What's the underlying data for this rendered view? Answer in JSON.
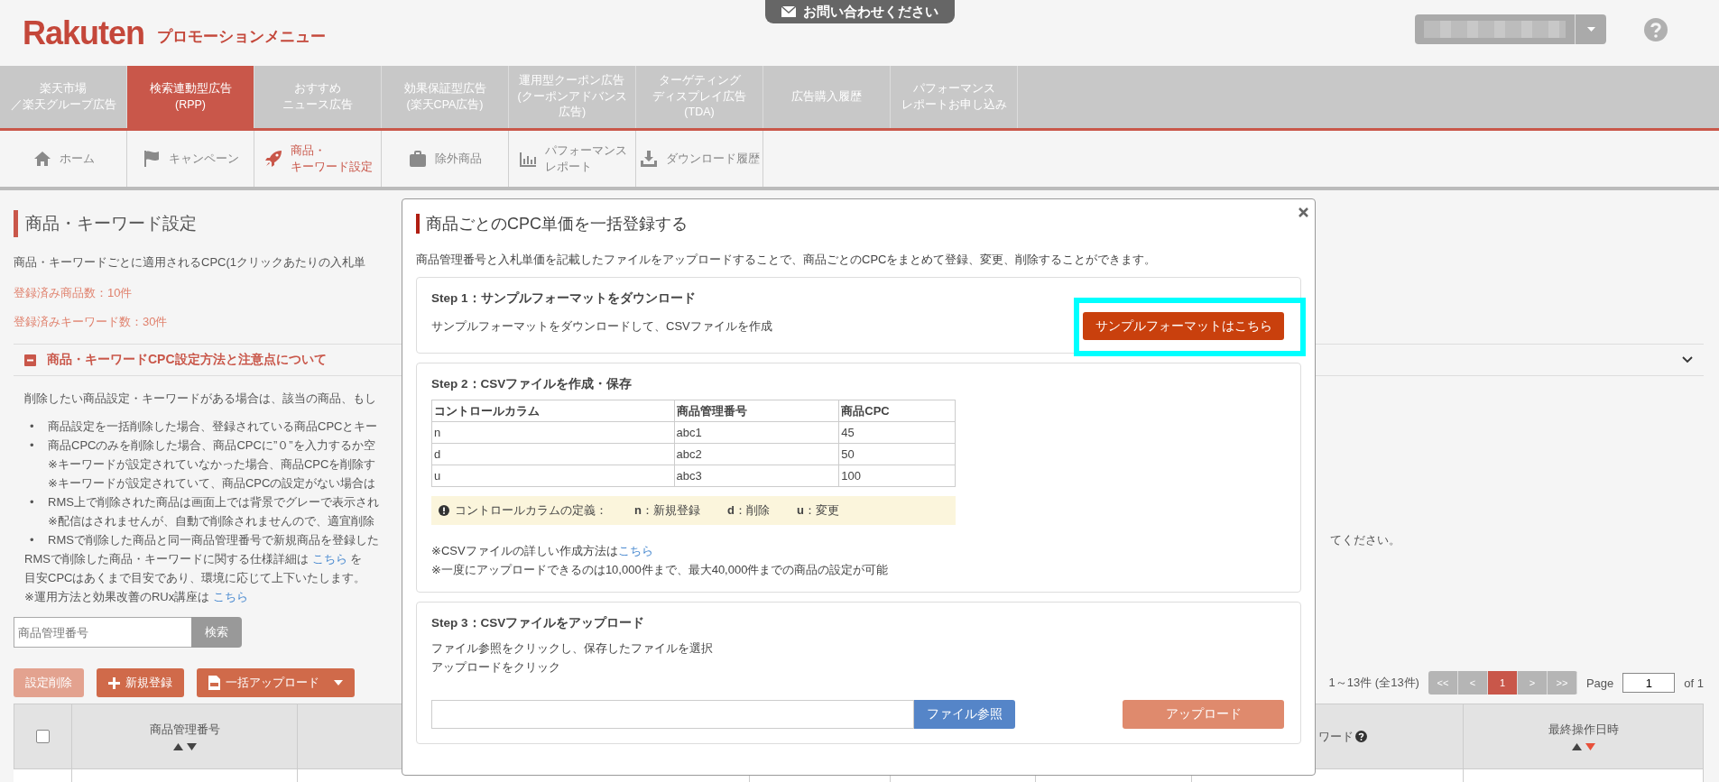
{
  "header": {
    "logo": "Rakuten",
    "subtitle": "プロモーションメニュー",
    "contact_tab": "お問い合わせください"
  },
  "main_nav": [
    {
      "lines": [
        "楽天市場",
        "／楽天グループ広告"
      ],
      "selected": false
    },
    {
      "lines": [
        "検索連動型広告",
        "(RPP)"
      ],
      "selected": true
    },
    {
      "lines": [
        "おすすめ",
        "ニュース広告"
      ],
      "selected": false
    },
    {
      "lines": [
        "効果保証型広告",
        "(楽天CPA広告)"
      ],
      "selected": false
    },
    {
      "lines": [
        "運用型クーポン広告",
        "(クーポンアドバンス",
        "広告)"
      ],
      "selected": false
    },
    {
      "lines": [
        "ターゲティング",
        "ディスプレイ広告",
        "(TDA)"
      ],
      "selected": false
    },
    {
      "lines": [
        "広告購入履歴"
      ],
      "selected": false
    },
    {
      "lines": [
        "パフォーマンス",
        "レポートお申し込み"
      ],
      "selected": false
    }
  ],
  "sub_nav": [
    {
      "lines": [
        "ホーム"
      ],
      "selected": false
    },
    {
      "lines": [
        "キャンペーン"
      ],
      "selected": false
    },
    {
      "lines": [
        "商品・",
        "キーワード設定"
      ],
      "selected": true
    },
    {
      "lines": [
        "除外商品"
      ],
      "selected": false
    },
    {
      "lines": [
        "パフォーマンス",
        "レポート"
      ],
      "selected": false
    },
    {
      "lines": [
        "ダウンロード履歴"
      ],
      "selected": false
    }
  ],
  "page": {
    "title": "商品・キーワード設定",
    "description": "商品・キーワードごとに適用されるCPC(1クリックあたりの入札単",
    "registered_items": "登録済み商品数：10件",
    "registered_keywords": "登録済みキーワード数：30件"
  },
  "notes": {
    "title": "商品・キーワードCPC設定方法と注意点について",
    "expanded": true,
    "intro": "削除したい商品設定・キーワードがある場合は、該当の商品、もし",
    "bullets": [
      {
        "marker": "•",
        "text": "商品設定を一括削除した場合、登録されている商品CPCとキー"
      },
      {
        "marker": "•",
        "text": "商品CPCのみを削除した場合、商品CPCに”０”を入力するか空",
        "sub": [
          "※キーワードが設定されていなかった場合、商品CPCを削除す",
          "※キーワードが設定されていて、商品CPCの設定がない場合は"
        ]
      },
      {
        "marker": "•",
        "text": "RMS上で削除された商品は画面上では背景でグレーで表示され",
        "sub": [
          "※配信はされませんが、自動で削除されませんので、適宜削除"
        ]
      },
      {
        "marker": "•",
        "text": "RMSで削除した商品と同一商品管理番号で新規商品を登録した",
        "continuation": "てください。"
      }
    ],
    "footer": [
      {
        "text": "RMSで削除した商品・キーワードに関する仕様詳細は",
        "link": "こちら",
        "after": "を"
      },
      {
        "text": "目安CPCはあくまで目安であり、環境に応じて上下いたします。"
      },
      {
        "text": "※運用方法と効果改善のRUx講座は",
        "link": "こちら"
      }
    ]
  },
  "search": {
    "placeholder": "商品管理番号",
    "button": "検索"
  },
  "actions": [
    {
      "label": "設定削除",
      "disabled": true
    },
    {
      "label": "新規登録",
      "disabled": false
    },
    {
      "label": "一括アップロード",
      "disabled": false
    }
  ],
  "pagination": {
    "summary": "1～13件 (全13件)",
    "buttons": [
      {
        "label": "<<",
        "selected": false
      },
      {
        "label": "<",
        "selected": false
      },
      {
        "label": "1",
        "selected": true
      },
      {
        "label": ">",
        "selected": false
      },
      {
        "label": ">>",
        "selected": false
      }
    ],
    "page_label": "Page",
    "page_value": "1",
    "page_total": "of 1"
  },
  "table": {
    "columns": [
      {
        "kind": "checkbox",
        "checked": false
      },
      {
        "kind": "sortable",
        "label": "商品管理番号",
        "sorted_descending": false
      },
      {
        "kind": "help",
        "label": "ワード"
      },
      {
        "kind": "sortable",
        "label": "最終操作日時",
        "sorted_descending": true
      }
    ]
  },
  "modal": {
    "title": "商品ごとのCPC単価を一括登録する",
    "description": "商品管理番号と入札単価を記載したファイルをアップロードすることで、商品ごとのCPCをまとめて登録、変更、削除することができます。",
    "steps": [
      {
        "kind": "download",
        "title": "Step 1：サンプルフォーマットをダウンロード",
        "text": "サンプルフォーマットをダウンロードして、CSVファイルを作成",
        "button": "サンプルフォーマットはこちら",
        "highlighted": true
      },
      {
        "kind": "table",
        "title": "Step 2：CSVファイルを作成・保存",
        "columns": [
          "コントロールカラム",
          "商品管理番号",
          "商品CPC"
        ],
        "rows": [
          [
            "n",
            "abc1",
            "45"
          ],
          [
            "d",
            "abc2",
            "50"
          ],
          [
            "u",
            "abc3",
            "100"
          ]
        ],
        "definition": {
          "label": "コントロールカラムの定義：",
          "items": [
            {
              "key": "n",
              "value": "：新規登録"
            },
            {
              "key": "d",
              "value": "：削除"
            },
            {
              "key": "u",
              "value": "：変更"
            }
          ]
        },
        "lines": [
          {
            "text": "※CSVファイルの詳しい作成方法は",
            "link": "こちら"
          },
          {
            "text": "※一度にアップロードできるのは10,000件まで、最大40,000件までの商品の設定が可能"
          }
        ]
      },
      {
        "kind": "upload",
        "title": "Step 3：CSVファイルをアップロード",
        "lines": [
          "ファイル参照をクリックし、保存したファイルを選択",
          "アップロードをクリック"
        ],
        "browse_button": "ファイル参照",
        "upload_button": {
          "label": "アップロード",
          "disabled": true
        }
      }
    ]
  }
}
